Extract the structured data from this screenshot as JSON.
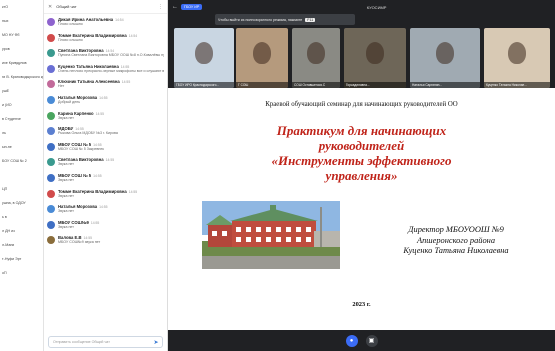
{
  "sidebar_left": {
    "items": [
      "ктО",
      "ных",
      "МО НУ Фб",
      "уров",
      "ихе Кривдулов",
      "ги В. Крановодырского кр",
      "ушЕ",
      "и (ИО",
      "в Студенче",
      "ль",
      "ын-пе",
      "БОУ СОШ № 2",
      "",
      "ЦП",
      "ушна, в ОДОУ",
      "ь в",
      "л ДН из",
      "л-Мани",
      "т-Нуфи Эрт",
      "оП"
    ]
  },
  "chat": {
    "title": "Общий чат",
    "input_placeholder": "Отправить сообщение Общий чат",
    "messages": [
      {
        "name": "Дикая Ирина Анатольевна",
        "time": "14:54",
        "text": "Плохо слышно",
        "color": "#8e63ce"
      },
      {
        "name": "Томме Екатерина Владимировна",
        "time": "14:54",
        "text": "Плохо слышно",
        "color": "#d14b4b"
      },
      {
        "name": "Светлана Викторовна",
        "time": "14:54",
        "text": "Пупина Светлана Викторовна МБОУ ООШ №8 п.О.Ковалёвы нужна МВ(нет)",
        "color": "#3a9a8f"
      },
      {
        "name": "Куценко Татьяна Николаевна",
        "time": "14:55",
        "text": "Очень неплохо прекрасно-черные микрофоны все и слушают вебинар",
        "color": "#6a6fd4"
      },
      {
        "name": "Ключник Татьяна Алексеевна",
        "time": "14:55",
        "text": "Нет",
        "color": "#c26a9a"
      },
      {
        "name": "Наталья Морозова",
        "time": "14:55",
        "text": "Добрый день",
        "color": "#4a8bd6"
      },
      {
        "name": "Карина Карпенко",
        "time": "14:55",
        "text": "Звука нет",
        "color": "#4aa55f"
      },
      {
        "name": "МДОБУ",
        "time": "14:55",
        "text": "Рыкова Ольга МДОБУ №3 г. Кирова",
        "color": "#5b7fd0"
      },
      {
        "name": "МБОУ СОШ № 5",
        "time": "14:55",
        "text": "МБОУ СОШ № 5 Закревнек",
        "color": "#3f6fc4"
      },
      {
        "name": "Светлана Викторовна",
        "time": "14:55",
        "text": "Звука нет",
        "color": "#3a9a8f"
      },
      {
        "name": "МБОУ СОШ № 5",
        "time": "14:55",
        "text": "Звука нет",
        "color": "#3f6fc4"
      },
      {
        "name": "Томме Екатерина Владимировна",
        "time": "14:55",
        "text": "Звука нет",
        "color": "#d14b4b"
      },
      {
        "name": "Наталья Морозова",
        "time": "14:55",
        "text": "Звука нет",
        "color": "#4a8bd6"
      },
      {
        "name": "МБОУ СОШ№9",
        "time": "14:55",
        "text": "Звука нет",
        "color": "#3f6fc4"
      },
      {
        "name": "Валова Е.В",
        "time": "14:55",
        "text": "МБОУ СОШ№9 звука нет",
        "color": "#8a6d3b"
      }
    ]
  },
  "topbar": {
    "tag": "ГБОУ ИР",
    "room": "КУОСИМР",
    "banner_text": "Чтобы выйти из полноэкранного режима, нажмите",
    "banner_key": "F11"
  },
  "thumbs": [
    {
      "caption": "ГБОУ ИРО Краснодарского...",
      "bg": "#c9d6e2"
    },
    {
      "caption": "Г СОШ",
      "bg": "#b59a7d"
    },
    {
      "caption": "СОШ Оставшегося.С",
      "bg": "#8a8a84"
    },
    {
      "caption": "Гиркадиловна...",
      "bg": "#6e6658"
    },
    {
      "caption": "Наталья Саргинян...",
      "bg": "#a0aab2"
    },
    {
      "caption": "Куценко Татьяна Николае...",
      "bg": "#d8c9b4"
    }
  ],
  "slide": {
    "top_line": "Краевой обучающий семинар для начинающих руководителей ОО",
    "title_1": "Практикум для начинающих",
    "title_2": "руководителей",
    "title_3": "«Инструменты эффективного",
    "title_4": "управления»",
    "sign_1": "Директор МБОУООШ №9",
    "sign_2": "Апшеронского района",
    "sign_3": "Куценко Татьяна Николаевна",
    "year": "2023 г."
  }
}
